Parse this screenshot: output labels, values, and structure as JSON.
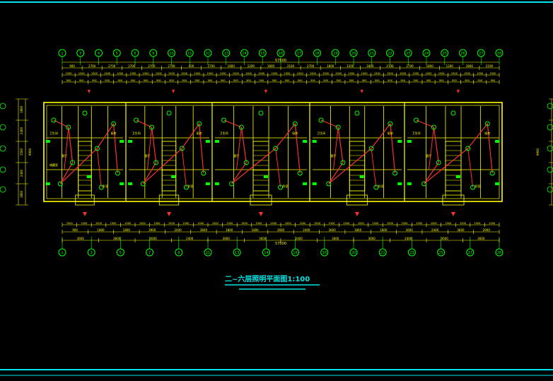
{
  "title": "二~六层照明平面图1:100",
  "overall_dim": "57500",
  "top_axes": [
    "1",
    "3",
    "4",
    "5",
    "6",
    "9",
    "10",
    "11",
    "12",
    "13",
    "14",
    "15",
    "16",
    "17",
    "18",
    "19",
    "20",
    "21",
    "22",
    "23",
    "24",
    "25",
    "26",
    "27",
    "28"
  ],
  "bottom_axes": [
    "1",
    "3",
    "5",
    "7",
    "9",
    "11",
    "13",
    "14",
    "16",
    "18",
    "20",
    "22",
    "23",
    "25",
    "27",
    "28"
  ],
  "top_row1": [
    "900",
    "2700",
    "2700",
    "2700",
    "2700",
    "2700",
    "600",
    "2700",
    "1800",
    "1200",
    "1800",
    "2100",
    "2700",
    "1800",
    "1200",
    "1800",
    "2100",
    "2700",
    "1800",
    "1200",
    "1800",
    "2100"
  ],
  "bottom_row1": [
    "900",
    "1800",
    "1800",
    "3900",
    "2400",
    "3600",
    "1800",
    "1800",
    "3600",
    "2400",
    "3600",
    "1800",
    "1800",
    "3600",
    "2400",
    "3600",
    "2900"
  ],
  "bottom_row2": [
    "3600",
    "3600",
    "3600",
    "2400",
    "3600",
    "3600",
    "2400",
    "3600",
    "3600",
    "2400",
    "3600",
    "3600"
  ],
  "left_dims": [
    "1800",
    "2400",
    "1500",
    "2400",
    "1800"
  ],
  "right_dims": [
    "1800",
    "2400",
    "1500",
    "2400",
    "1800"
  ],
  "total_height": "9900",
  "room_labels": [
    "卫生间",
    "厨房",
    "客厅",
    "卧室",
    "阳台",
    "楼梯间",
    "储藏室"
  ],
  "colors": {
    "background": "#000000",
    "walls": "#ffff00",
    "wiring": "#ff3030",
    "fixtures": "#00ff00",
    "axes": "#00ff00",
    "frame": "#00e5e5",
    "title": "#00e5e5"
  }
}
